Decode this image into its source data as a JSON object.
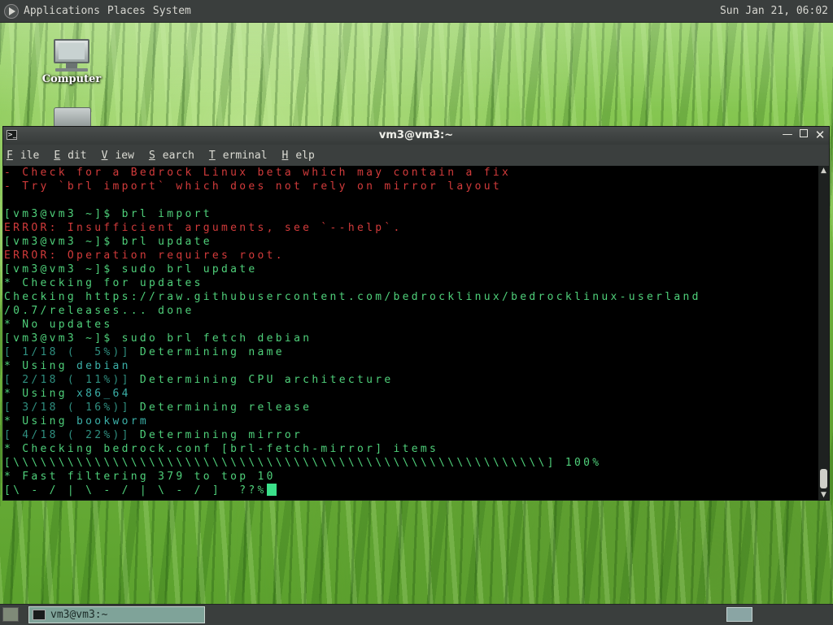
{
  "top_panel": {
    "menus": [
      "Applications",
      "Places",
      "System"
    ],
    "clock": "Sun Jan 21, 06:02"
  },
  "desktop": {
    "computer_label": "Computer"
  },
  "window": {
    "title": "vm3@vm3:~",
    "menus": [
      {
        "label": "File",
        "mnemonic": "F",
        "rest": "ile"
      },
      {
        "label": "Edit",
        "mnemonic": "E",
        "rest": "dit"
      },
      {
        "label": "View",
        "mnemonic": "V",
        "rest": "iew"
      },
      {
        "label": "Search",
        "mnemonic": "S",
        "rest": "earch"
      },
      {
        "label": "Terminal",
        "mnemonic": "T",
        "rest": "erminal"
      },
      {
        "label": "Help",
        "mnemonic": "H",
        "rest": "elp"
      }
    ]
  },
  "terminal": {
    "lines": [
      [
        {
          "t": "- Check for a Bedrock Linux beta which may contain a fix",
          "c": "red"
        }
      ],
      [
        {
          "t": "- Try `brl import` which does not rely on mirror layout",
          "c": "red"
        }
      ],
      [],
      [
        {
          "t": "[vm3@vm3 ~]$ ",
          "c": "green"
        },
        {
          "t": "brl import",
          "c": "green"
        }
      ],
      [
        {
          "t": "ERROR: Insufficient arguments, see `--help`.",
          "c": "red"
        }
      ],
      [
        {
          "t": "[vm3@vm3 ~]$ ",
          "c": "green"
        },
        {
          "t": "brl update",
          "c": "green"
        }
      ],
      [
        {
          "t": "ERROR: Operation requires root.",
          "c": "red"
        }
      ],
      [
        {
          "t": "[vm3@vm3 ~]$ ",
          "c": "green"
        },
        {
          "t": "sudo brl update",
          "c": "green"
        }
      ],
      [
        {
          "t": "* Checking for updates",
          "c": "green"
        }
      ],
      [
        {
          "t": "Checking https://raw.githubusercontent.com/bedrocklinux/bedrocklinux-userland",
          "c": "green"
        }
      ],
      [
        {
          "t": "/0.7/releases... done",
          "c": "green"
        }
      ],
      [
        {
          "t": "* No updates",
          "c": "green"
        }
      ],
      [
        {
          "t": "[vm3@vm3 ~]$ ",
          "c": "green"
        },
        {
          "t": "sudo brl fetch debian",
          "c": "green"
        }
      ],
      [
        {
          "t": "[ 1/18 (  5%)] ",
          "c": "dim"
        },
        {
          "t": "Determining name",
          "c": "green"
        }
      ],
      [
        {
          "t": "* Using ",
          "c": "green"
        },
        {
          "t": "debian",
          "c": "teal"
        }
      ],
      [
        {
          "t": "[ 2/18 ( 11%)] ",
          "c": "dim"
        },
        {
          "t": "Determining CPU architecture",
          "c": "green"
        }
      ],
      [
        {
          "t": "* Using ",
          "c": "green"
        },
        {
          "t": "x86_64",
          "c": "teal"
        }
      ],
      [
        {
          "t": "[ 3/18 ( 16%)] ",
          "c": "dim"
        },
        {
          "t": "Determining release",
          "c": "green"
        }
      ],
      [
        {
          "t": "* Using ",
          "c": "green"
        },
        {
          "t": "bookworm",
          "c": "teal"
        }
      ],
      [
        {
          "t": "[ 4/18 ( 22%)] ",
          "c": "dim"
        },
        {
          "t": "Determining mirror",
          "c": "green"
        }
      ],
      [
        {
          "t": "* Checking bedrock.conf [brl-fetch-mirror] items",
          "c": "green"
        }
      ],
      [
        {
          "t": "[\\\\\\\\\\\\\\\\\\\\\\\\\\\\\\\\\\\\\\\\\\\\\\\\\\\\\\\\\\\\\\\\\\\\\\\\\\\\\\\\\\\\\\\\\\\\\\\\\\\\\\\\\\\\\\\\\\\\\\] 100%",
          "c": "green"
        }
      ],
      [
        {
          "t": "* Fast filtering 379 to top 10",
          "c": "green"
        }
      ],
      [
        {
          "t": "[\\ - / | \\ - / | \\ - / ]  ??%",
          "c": "green"
        }
      ]
    ]
  },
  "taskbar": {
    "task_label": "vm3@vm3:~"
  }
}
